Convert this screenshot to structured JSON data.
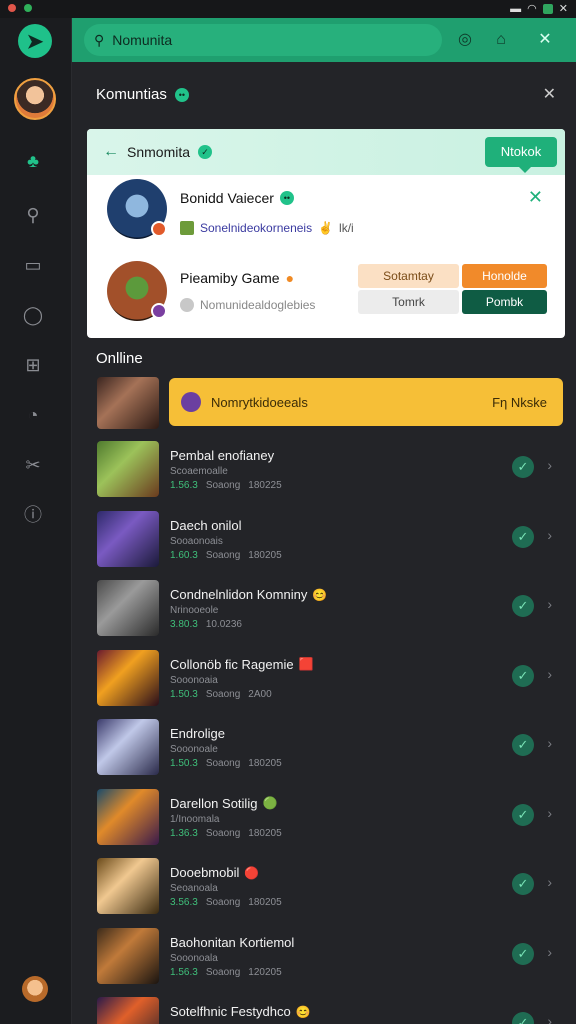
{
  "topbar": {
    "search_value": "Nomunita"
  },
  "header": {
    "title": "Komuntias"
  },
  "card": {
    "title": "Snmomita",
    "badge": "Ntokok",
    "rows": [
      {
        "name": "Bonidd Vaiecer",
        "sub": "Sonelnideokorneneis",
        "sub_extra": "lk/i"
      },
      {
        "name": "Pieamiby Game",
        "sub": "Nomunidealdoglebies"
      }
    ],
    "buttons": {
      "a": "Sotamtay",
      "b": "Honolde",
      "c": "Tomrk",
      "d": "Pombk"
    }
  },
  "online": {
    "label": "Onlline",
    "featured": {
      "text": "Nomrytkidoeeals",
      "right": "Fη Nkske"
    },
    "items": [
      {
        "name": "Pembal enofianey",
        "sub": "Scoaemoalle",
        "meta": [
          "1.56.3",
          "Soaong",
          "180225"
        ],
        "emoji": ""
      },
      {
        "name": "Daech onilol",
        "sub": "Sooaonoais",
        "meta": [
          "1.60.3",
          "Soaong",
          "180205"
        ],
        "emoji": ""
      },
      {
        "name": "Condnelnlidon Komniny",
        "sub": "Nrinooeole",
        "meta": [
          "3.80.3",
          "10.0236",
          ""
        ],
        "emoji": "😊"
      },
      {
        "name": "Collonöb fic Ragemie",
        "sub": "Sooonoaia",
        "meta": [
          "1.50.3",
          "Soaong",
          "2A00"
        ],
        "emoji": "🟥"
      },
      {
        "name": "Endrolige",
        "sub": "Sooonoale",
        "meta": [
          "1.50.3",
          "Soaong",
          "180205"
        ],
        "emoji": ""
      },
      {
        "name": "Darellon Sotilig",
        "sub": "1/Inoomala",
        "meta": [
          "1.36.3",
          "Soaong",
          "180205"
        ],
        "emoji": "🟢"
      },
      {
        "name": "Dooebmobil",
        "sub": "Seoanoala",
        "meta": [
          "3.56.3",
          "Soaong",
          "180205"
        ],
        "emoji": "🔴"
      },
      {
        "name": "Baohonitan Kortiemol",
        "sub": "Sooonoala",
        "meta": [
          "1.56.3",
          "Soaong",
          "120205"
        ],
        "emoji": ""
      },
      {
        "name": "Sotelfhnic Festydhco",
        "sub": "",
        "meta": [],
        "emoji": "😊"
      }
    ]
  },
  "colors": {
    "accent": "#1f9f6f",
    "featured": "#f6bf37",
    "check": "#1f6c53"
  }
}
